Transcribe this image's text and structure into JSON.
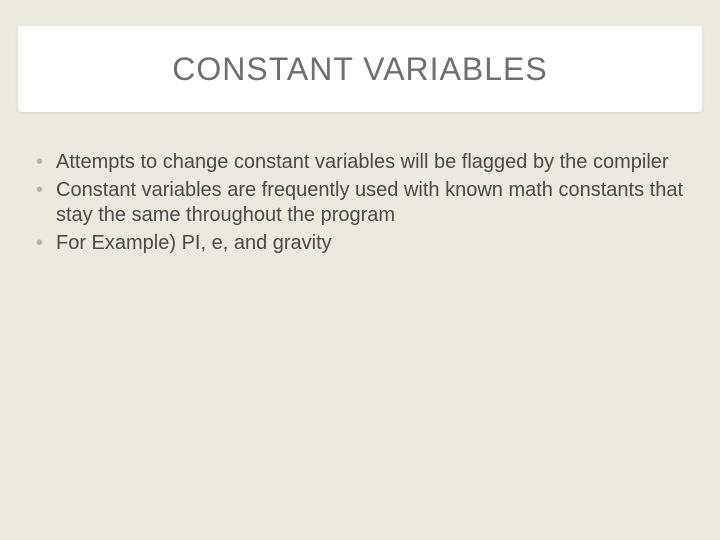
{
  "slide": {
    "title": "CONSTANT VARIABLES",
    "bullets": [
      "Attempts to change constant variables will be flagged by the compiler",
      "Constant variables are frequently used with known math constants that stay the same throughout the program",
      "For Example)  PI, e, and gravity"
    ]
  }
}
